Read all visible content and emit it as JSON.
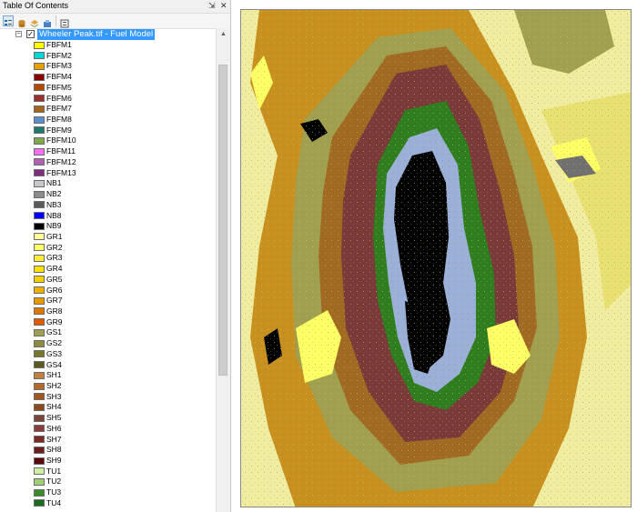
{
  "toc": {
    "title": "Table Of Contents",
    "pin_glyph": "⇲",
    "close_glyph": "✕",
    "layer": {
      "name": "Wheeler Peak.tif - Fuel Model",
      "checked": true
    }
  },
  "legend": [
    {
      "label": "FBFM1",
      "color": "#ffff00"
    },
    {
      "label": "FBFM2",
      "color": "#00d8d8"
    },
    {
      "label": "FBFM3",
      "color": "#e6a000"
    },
    {
      "label": "FBFM4",
      "color": "#8b0000"
    },
    {
      "label": "FBFM5",
      "color": "#b34a00"
    },
    {
      "label": "FBFM6",
      "color": "#9a2f2f"
    },
    {
      "label": "FBFM7",
      "color": "#a0661e"
    },
    {
      "label": "FBFM8",
      "color": "#5b8fcf"
    },
    {
      "label": "FBFM9",
      "color": "#1f7a6e"
    },
    {
      "label": "FBFM10",
      "color": "#7fa84a"
    },
    {
      "label": "FBFM11",
      "color": "#f56ef5"
    },
    {
      "label": "FBFM12",
      "color": "#b061b0"
    },
    {
      "label": "FBFM13",
      "color": "#7d2f7d"
    },
    {
      "label": "NB1",
      "color": "#c8c8c8"
    },
    {
      "label": "NB2",
      "color": "#8c8c8c"
    },
    {
      "label": "NB3",
      "color": "#5a5a5a"
    },
    {
      "label": "NB8",
      "color": "#0000ff"
    },
    {
      "label": "NB9",
      "color": "#000000"
    },
    {
      "label": "GR1",
      "color": "#ffff99"
    },
    {
      "label": "GR2",
      "color": "#ffff66"
    },
    {
      "label": "GR3",
      "color": "#ffee33"
    },
    {
      "label": "GR4",
      "color": "#ffe000"
    },
    {
      "label": "GR5",
      "color": "#f5d000"
    },
    {
      "label": "GR6",
      "color": "#f0b000"
    },
    {
      "label": "GR7",
      "color": "#e89a00"
    },
    {
      "label": "GR8",
      "color": "#e07800"
    },
    {
      "label": "GR9",
      "color": "#e05a00"
    },
    {
      "label": "GS1",
      "color": "#a0a050"
    },
    {
      "label": "GS2",
      "color": "#8c8c3c"
    },
    {
      "label": "GS3",
      "color": "#78782d"
    },
    {
      "label": "GS4",
      "color": "#5a5a1e"
    },
    {
      "label": "SH1",
      "color": "#c08040"
    },
    {
      "label": "SH2",
      "color": "#b06a2a"
    },
    {
      "label": "SH3",
      "color": "#a0561e"
    },
    {
      "label": "SH4",
      "color": "#8c4a1e"
    },
    {
      "label": "SH5",
      "color": "#7a4438"
    },
    {
      "label": "SH6",
      "color": "#8c3c3c"
    },
    {
      "label": "SH7",
      "color": "#7a2828"
    },
    {
      "label": "SH8",
      "color": "#6a1e1e"
    },
    {
      "label": "SH9",
      "color": "#5a0a0a"
    },
    {
      "label": "TU1",
      "color": "#ccf0a0"
    },
    {
      "label": "TU2",
      "color": "#a0d070"
    },
    {
      "label": "TU3",
      "color": "#3a8c28"
    },
    {
      "label": "TU4",
      "color": "#1e6a1e"
    }
  ],
  "map_colors": {
    "grass_light": "#f0eca0",
    "grass_yellow": "#e8e070",
    "gs_olive": "#a0a050",
    "gs_dark": "#7a7a32",
    "sh_orange": "#c8901e",
    "sh_brown": "#a06a22",
    "sh_maroon": "#7a3a3a",
    "tu_green": "#2e7d1e",
    "nb_blue": "#9ab0d8",
    "nb_gray": "#707070",
    "nb_black": "#000000",
    "gr_bright": "#ffff66"
  }
}
